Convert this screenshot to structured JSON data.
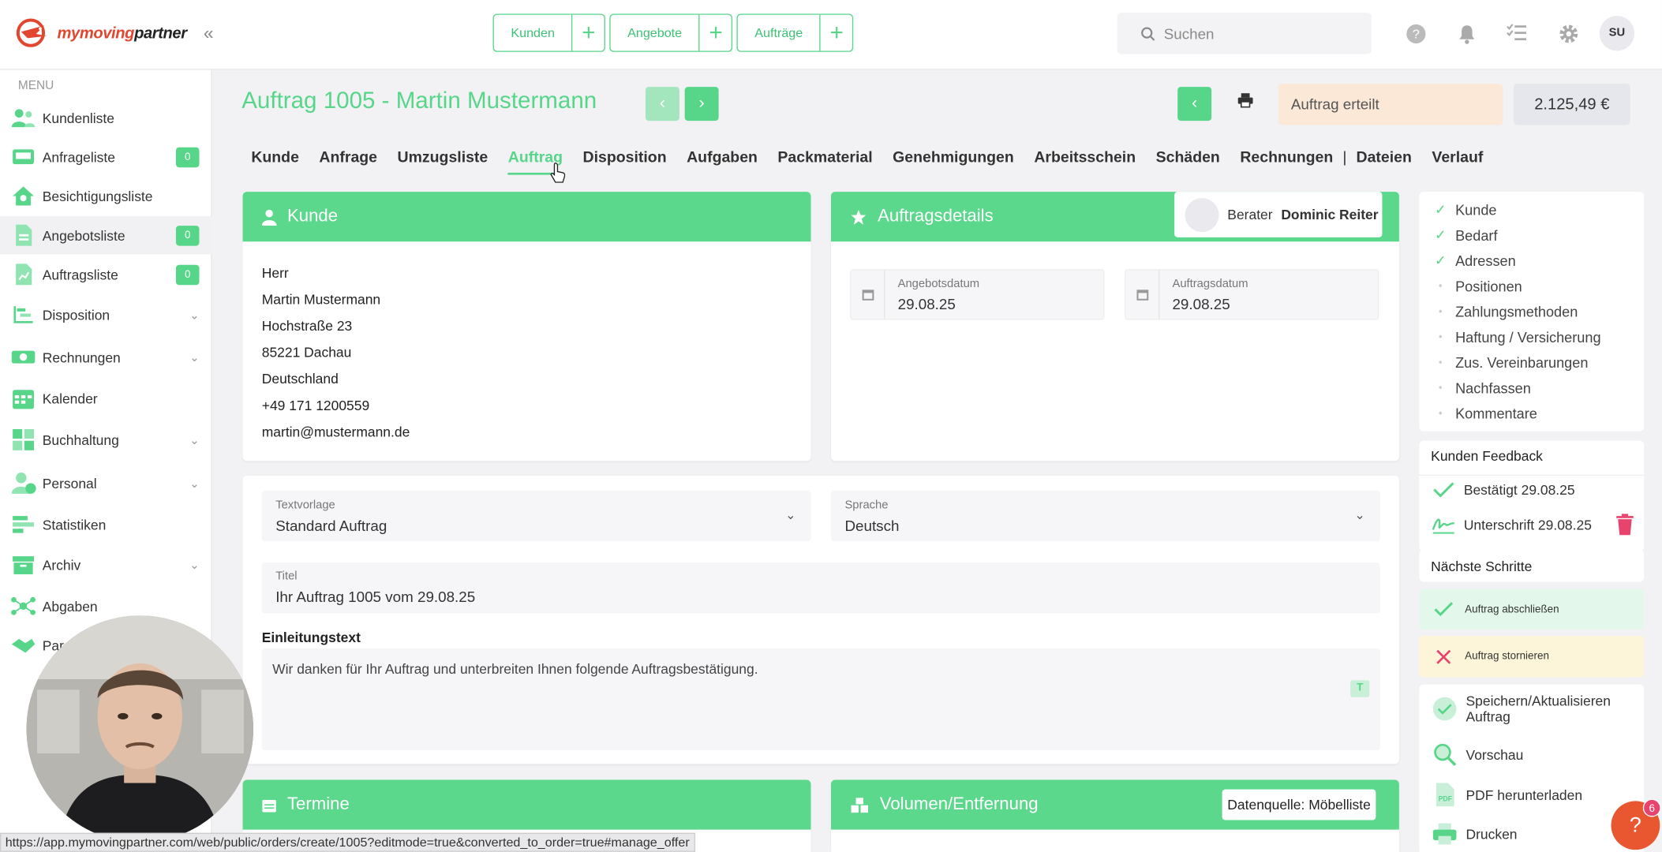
{
  "brand": {
    "part1": "mymoving",
    "part2": "partner"
  },
  "top_actions": [
    {
      "label": "Kunden"
    },
    {
      "label": "Angebote"
    },
    {
      "label": "Aufträge"
    }
  ],
  "search": {
    "placeholder": "Suchen"
  },
  "user": {
    "initials": "SU"
  },
  "sidebar": {
    "heading": "MENU",
    "items": [
      {
        "label": "Kundenliste",
        "icon": "customers-icon"
      },
      {
        "label": "Anfrageliste",
        "icon": "inbox-icon",
        "badge": "0"
      },
      {
        "label": "Besichtigungsliste",
        "icon": "house-icon"
      },
      {
        "label": "Angebotsliste",
        "icon": "offer-document-icon",
        "badge": "0",
        "active": true
      },
      {
        "label": "Auftragsliste",
        "icon": "order-document-icon",
        "badge": "0"
      },
      {
        "label": "Disposition",
        "icon": "gantt-icon",
        "expandable": true
      },
      {
        "label": "Rechnungen",
        "icon": "money-icon",
        "expandable": true
      },
      {
        "label": "Kalender",
        "icon": "calendar-icon"
      },
      {
        "label": "Buchhaltung",
        "icon": "accounting-icon",
        "expandable": true
      },
      {
        "label": "Personal",
        "icon": "staff-icon",
        "expandable": true
      },
      {
        "label": "Statistiken",
        "icon": "statistics-icon"
      },
      {
        "label": "Archiv",
        "icon": "archive-icon",
        "expandable": true
      },
      {
        "label": "Abgaben",
        "icon": "network-icon"
      },
      {
        "label": "Par",
        "icon": "partner-icon"
      }
    ]
  },
  "order": {
    "title": "Auftrag 1005 - Martin Mustermann",
    "status": "Auftrag erteilt",
    "amount": "2.125,49 €"
  },
  "tabs": [
    "Kunde",
    "Anfrage",
    "Umzugsliste",
    "Auftrag",
    "Disposition",
    "Aufgaben",
    "Packmaterial",
    "Genehmigungen",
    "Arbeitsschein",
    "Schäden",
    "Rechnungen",
    "|",
    "Dateien",
    "Verlauf"
  ],
  "customer_card": {
    "title": "Kunde",
    "lines": [
      "Herr",
      "Martin Mustermann",
      "Hochstraße 23",
      "85221 Dachau",
      "Deutschland",
      "+49 171 1200559",
      "martin@mustermann.de"
    ]
  },
  "details_card": {
    "title": "Auftragsdetails",
    "advisor_label": "Berater",
    "advisor_name": "Dominic Reiter",
    "offer_date_label": "Angebotsdatum",
    "offer_date": "29.08.25",
    "order_date_label": "Auftragsdatum",
    "order_date": "29.08.25"
  },
  "text_form": {
    "template_label": "Textvorlage",
    "template_value": "Standard Auftrag",
    "lang_label": "Sprache",
    "lang_value": "Deutsch",
    "title_label": "Titel",
    "title_value": "Ihr Auftrag 1005 vom 29.08.25",
    "intro_label": "Einleitungstext",
    "intro_value": "Wir danken für Ihr Auftrag und unterbreiten Ihnen folgende Auftragsbestätigung."
  },
  "bottom_cards": {
    "termine": "Termine",
    "volumen": "Volumen/Entfernung",
    "source": "Datenquelle: Möbelliste"
  },
  "checklist": [
    {
      "label": "Kunde",
      "done": true
    },
    {
      "label": "Bedarf",
      "done": true
    },
    {
      "label": "Adressen",
      "done": true
    },
    {
      "label": "Positionen",
      "done": false
    },
    {
      "label": "Zahlungsmethoden",
      "done": false
    },
    {
      "label": "Haftung / Versicherung",
      "done": false
    },
    {
      "label": "Zus. Vereinbarungen",
      "done": false
    },
    {
      "label": "Nachfassen",
      "done": false
    },
    {
      "label": "Kommentare",
      "done": false
    }
  ],
  "feedback": {
    "title": "Kunden Feedback",
    "confirmed": "Bestätigt 29.08.25",
    "signature": "Unterschrift 29.08.25"
  },
  "next_steps": {
    "title": "Nächste Schritte",
    "complete": "Auftrag abschließen",
    "cancel": "Auftrag stornieren"
  },
  "actions": {
    "save": "Speichern/Aktualisieren Auftrag",
    "preview": "Vorschau",
    "pdf": "PDF herunterladen",
    "print": "Drucken"
  },
  "help": {
    "badge": "6"
  },
  "status_url": "https://app.mymovingpartner.com/web/public/orders/create/1005?editmode=true&converted_to_order=true#manage_offer",
  "colors": {
    "accent": "#57d68a",
    "status_bg": "#fbe8d7",
    "cancel_bg": "#fdf5d9",
    "complete_bg": "#e3f8ea",
    "help": "#e8572f"
  }
}
